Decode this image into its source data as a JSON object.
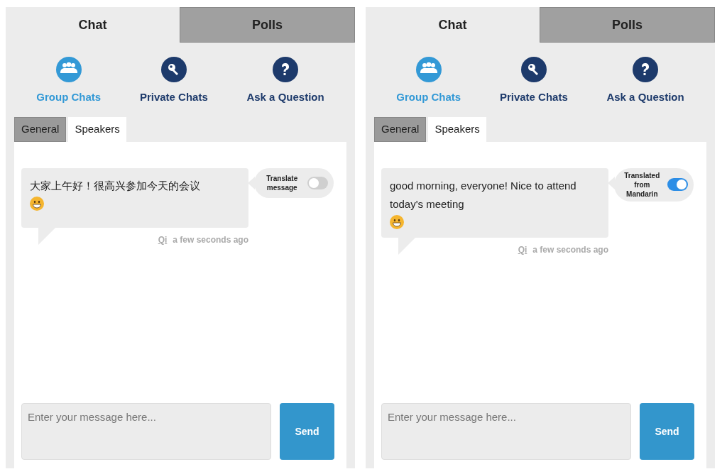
{
  "panels": [
    {
      "tabs": [
        {
          "label": "Chat",
          "selected": true
        },
        {
          "label": "Polls",
          "selected": false
        }
      ],
      "nav": [
        {
          "label": "Group Chats",
          "kind": "group",
          "selected": true
        },
        {
          "label": "Private Chats",
          "kind": "key",
          "selected": false
        },
        {
          "label": "Ask a Question",
          "kind": "question",
          "selected": false
        }
      ],
      "subtabs": [
        {
          "label": "General",
          "selected": false
        },
        {
          "label": "Speakers",
          "selected": true
        }
      ],
      "message": {
        "text": "大家上午好！很高兴参加今天的会议",
        "emoji": true,
        "author": "Qi",
        "time": "a few seconds ago"
      },
      "translate": {
        "label": "Translate message",
        "on": false
      },
      "composer": {
        "placeholder": "Enter your message here...",
        "button": "Send"
      }
    },
    {
      "tabs": [
        {
          "label": "Chat",
          "selected": true
        },
        {
          "label": "Polls",
          "selected": false
        }
      ],
      "nav": [
        {
          "label": "Group Chats",
          "kind": "group",
          "selected": true
        },
        {
          "label": "Private Chats",
          "kind": "key",
          "selected": false
        },
        {
          "label": "Ask a Question",
          "kind": "question",
          "selected": false
        }
      ],
      "subtabs": [
        {
          "label": "General",
          "selected": false
        },
        {
          "label": "Speakers",
          "selected": true
        }
      ],
      "message": {
        "text": "good morning, everyone! Nice to attend today's meeting",
        "emoji": true,
        "author": "Qi",
        "time": "a few seconds ago"
      },
      "translate": {
        "label": "Translated from Mandarin",
        "on": true
      },
      "composer": {
        "placeholder": "Enter your message here...",
        "button": "Send"
      }
    }
  ]
}
